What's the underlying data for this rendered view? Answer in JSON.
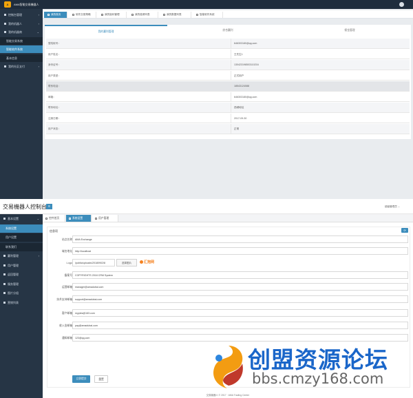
{
  "panel1": {
    "brand": "AMA智能交易機器人",
    "logo_text": "A",
    "sidebar": [
      {
        "label": "控制台管理",
        "caret": "›"
      },
      {
        "label": "我的机器人",
        "caret": "›"
      },
      {
        "label": "我的机器商",
        "caret": "⌄"
      },
      {
        "label": "智能交易系统",
        "sub": true
      },
      {
        "label": "智能软件系统",
        "sub": true,
        "active": true
      },
      {
        "label": "基本信息",
        "sub": true
      },
      {
        "label": "我的社区支付",
        "caret": "›"
      }
    ],
    "tabs": [
      {
        "label": "我的首页",
        "active": true
      },
      {
        "label": "软件交易策略"
      },
      {
        "label": "我的赢利管理"
      },
      {
        "label": "我的邀请列表"
      },
      {
        "label": "我的数据列表"
      },
      {
        "label": "智能软件系统"
      }
    ],
    "subtabs": [
      "我的赢利管理",
      "综合赢利",
      "佣金管理"
    ],
    "details": [
      {
        "label": "登陆帐号：",
        "value": "646303180@qq.com"
      },
      {
        "label": "用户姓名：",
        "value": "王先生1"
      },
      {
        "label": "身份证号：",
        "value": "130423198503110216"
      },
      {
        "label": "用户类型：",
        "value": "正式用户"
      },
      {
        "label": "联系电话：",
        "value": "18543124088"
      },
      {
        "label": "邮箱：",
        "value": "646303180@qq.com"
      },
      {
        "label": "联系地址：",
        "value": "西城地址"
      },
      {
        "label": "注册日期：",
        "value": "2017-09-30"
      },
      {
        "label": "用户状态：",
        "value": "正常"
      }
    ]
  },
  "panel2": {
    "title": "交易機器人控制台",
    "menu_icon": "≡",
    "admin": "超级管理员 ⌄",
    "sidebar": [
      {
        "label": "基本设置",
        "caret": "⌄"
      },
      {
        "label": "系统设置",
        "sub": true,
        "active": true
      },
      {
        "label": "用户设置",
        "sub": true
      },
      {
        "label": "联系我们",
        "sub": true
      },
      {
        "label": "赢利管理",
        "caret": "›"
      },
      {
        "label": "用户管理"
      },
      {
        "label": "返回管理"
      },
      {
        "label": "服务管理"
      },
      {
        "label": "图片分组"
      },
      {
        "label": "营销列表"
      }
    ],
    "tabs": [
      {
        "label": "控件首页"
      },
      {
        "label": "系统设置",
        "active": true
      },
      {
        "label": "用户管理"
      }
    ],
    "form_title": "信息项",
    "refresh_icon": "⟳",
    "fields": [
      {
        "label": "站点名称",
        "value": "AMA Exchange"
      },
      {
        "label": "域名地址",
        "value": "http://localhost"
      },
      {
        "label": "Logo",
        "value": "/public/uploads/20180902/8",
        "upload": "选择图片",
        "preview": "汇抱网"
      },
      {
        "label": "备案号",
        "value": "COPYRIGHTS 2018 CRM System"
      },
      {
        "label": "运营邮箱",
        "value": "manager@amadubai.com"
      },
      {
        "label": "技术支持邮箱",
        "value": "support@amadubai.com"
      },
      {
        "label": "客户邮箱",
        "value": "mypies@163.com"
      },
      {
        "label": "收入金邮箱",
        "value": "pay@amadubai.com"
      },
      {
        "label": "通知邮箱",
        "value": "123@qq.com"
      }
    ],
    "save": "立即提交",
    "reset": "重置",
    "footer": "交易機器人 © 2017 · AMA Trading Center"
  },
  "watermark": {
    "cn": "创盟资源论坛",
    "url": "bbs.cmzy168.com"
  }
}
